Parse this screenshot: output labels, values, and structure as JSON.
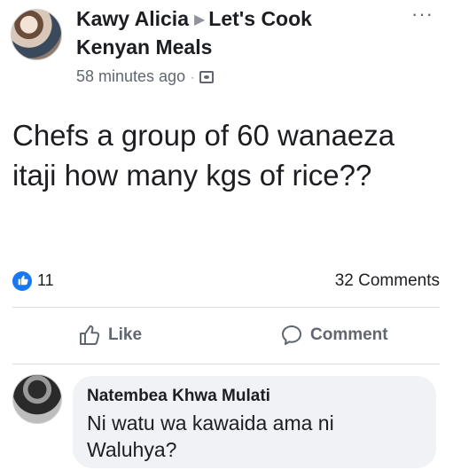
{
  "post": {
    "author": "Kawy Alicia",
    "group": "Let's Cook Kenyan Meals",
    "time": "58 minutes ago",
    "separator": "·",
    "more": "···",
    "text": "Chefs a group of 60 wanaeza itaji how many kgs of rice??",
    "privacy_icon": "group-icon"
  },
  "stats": {
    "likes": "11",
    "comments": "32 Comments"
  },
  "actions": {
    "like_label": "Like",
    "comment_label": "Comment"
  },
  "comment": {
    "author": "Natembea Khwa Mulati",
    "text": "Ni watu wa kawaida ama ni Waluhya?"
  },
  "colors": {
    "accent": "#1877f2",
    "muted": "#606770",
    "bubble": "#f0f2f5"
  }
}
